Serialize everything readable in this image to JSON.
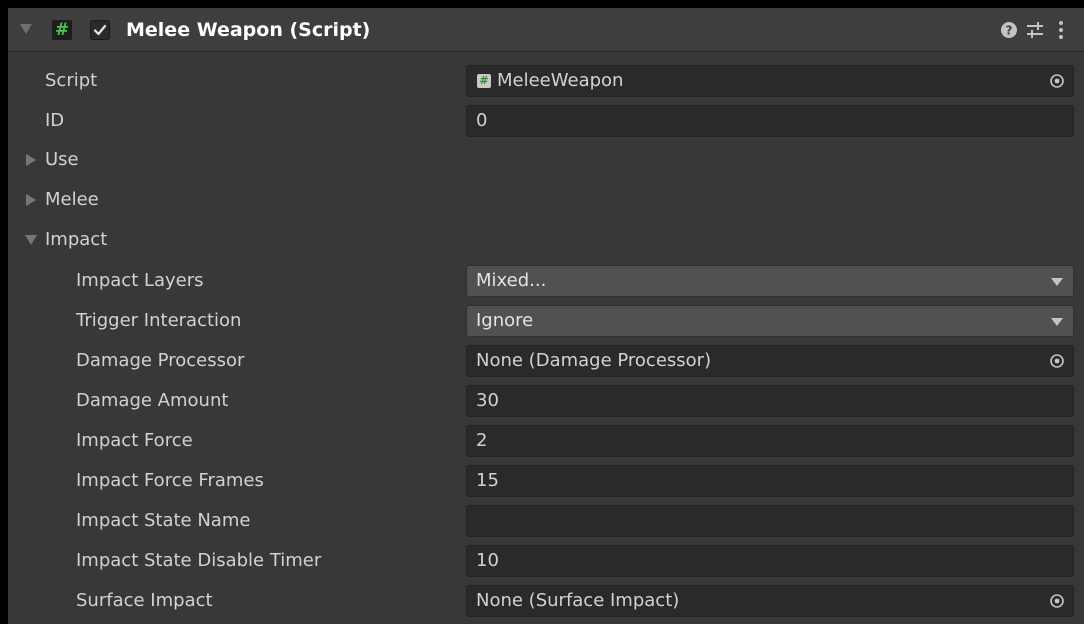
{
  "component": {
    "title": "Melee Weapon (Script)",
    "enabled": true
  },
  "header_icons": [
    "help-icon",
    "presets-icon",
    "context-menu-icon"
  ],
  "fields": {
    "script": {
      "label": "Script",
      "value": "MeleeWeapon"
    },
    "id": {
      "label": "ID",
      "value": "0"
    }
  },
  "foldouts": {
    "use": {
      "label": "Use",
      "expanded": false
    },
    "melee": {
      "label": "Melee",
      "expanded": false
    },
    "impact": {
      "label": "Impact",
      "expanded": true
    }
  },
  "impact": {
    "impact_layers": {
      "label": "Impact Layers",
      "value": "Mixed..."
    },
    "trigger_interaction": {
      "label": "Trigger Interaction",
      "value": "Ignore"
    },
    "damage_processor": {
      "label": "Damage Processor",
      "value": "None (Damage Processor)"
    },
    "damage_amount": {
      "label": "Damage Amount",
      "value": "30"
    },
    "impact_force": {
      "label": "Impact Force",
      "value": "2"
    },
    "impact_force_frames": {
      "label": "Impact Force Frames",
      "value": "15"
    },
    "impact_state_name": {
      "label": "Impact State Name",
      "value": ""
    },
    "impact_state_disable_timer": {
      "label": "Impact State Disable Timer",
      "value": "10"
    },
    "surface_impact": {
      "label": "Surface Impact",
      "value": "None (Surface Impact)"
    }
  },
  "colors": {
    "background": "#383838",
    "header": "#3e3e3e",
    "field": "#2a2a2a",
    "dropdown": "#515151",
    "text": "#d2d2d2",
    "script_icon_accent": "#4ec24e"
  }
}
